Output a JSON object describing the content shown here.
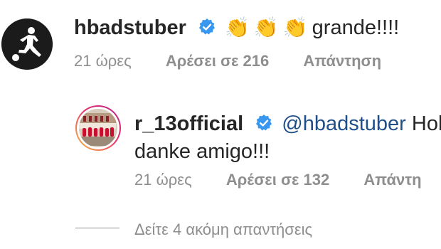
{
  "comment1": {
    "username": "hbadstuber",
    "claps": [
      "👏",
      "👏",
      "👏"
    ],
    "text": "grande!!!!",
    "time": "21 ώρες",
    "likes": "Αρέσει σε 216",
    "reply": "Απάντηση"
  },
  "comment2": {
    "username": "r_13official",
    "mention": "@hbadstuber",
    "text_line1": "Holg",
    "text_line2": "danke amigo!!!",
    "time": "21 ώρες",
    "likes": "Αρέσει σε 132",
    "reply": "Απάντη"
  },
  "view_more_replies": "Δείτε 4 ακόμη απαντήσεις",
  "colors": {
    "verified_blue": "#3897f0",
    "mention_blue": "#1f4f8a",
    "meta_gray": "#8e8e8e"
  }
}
